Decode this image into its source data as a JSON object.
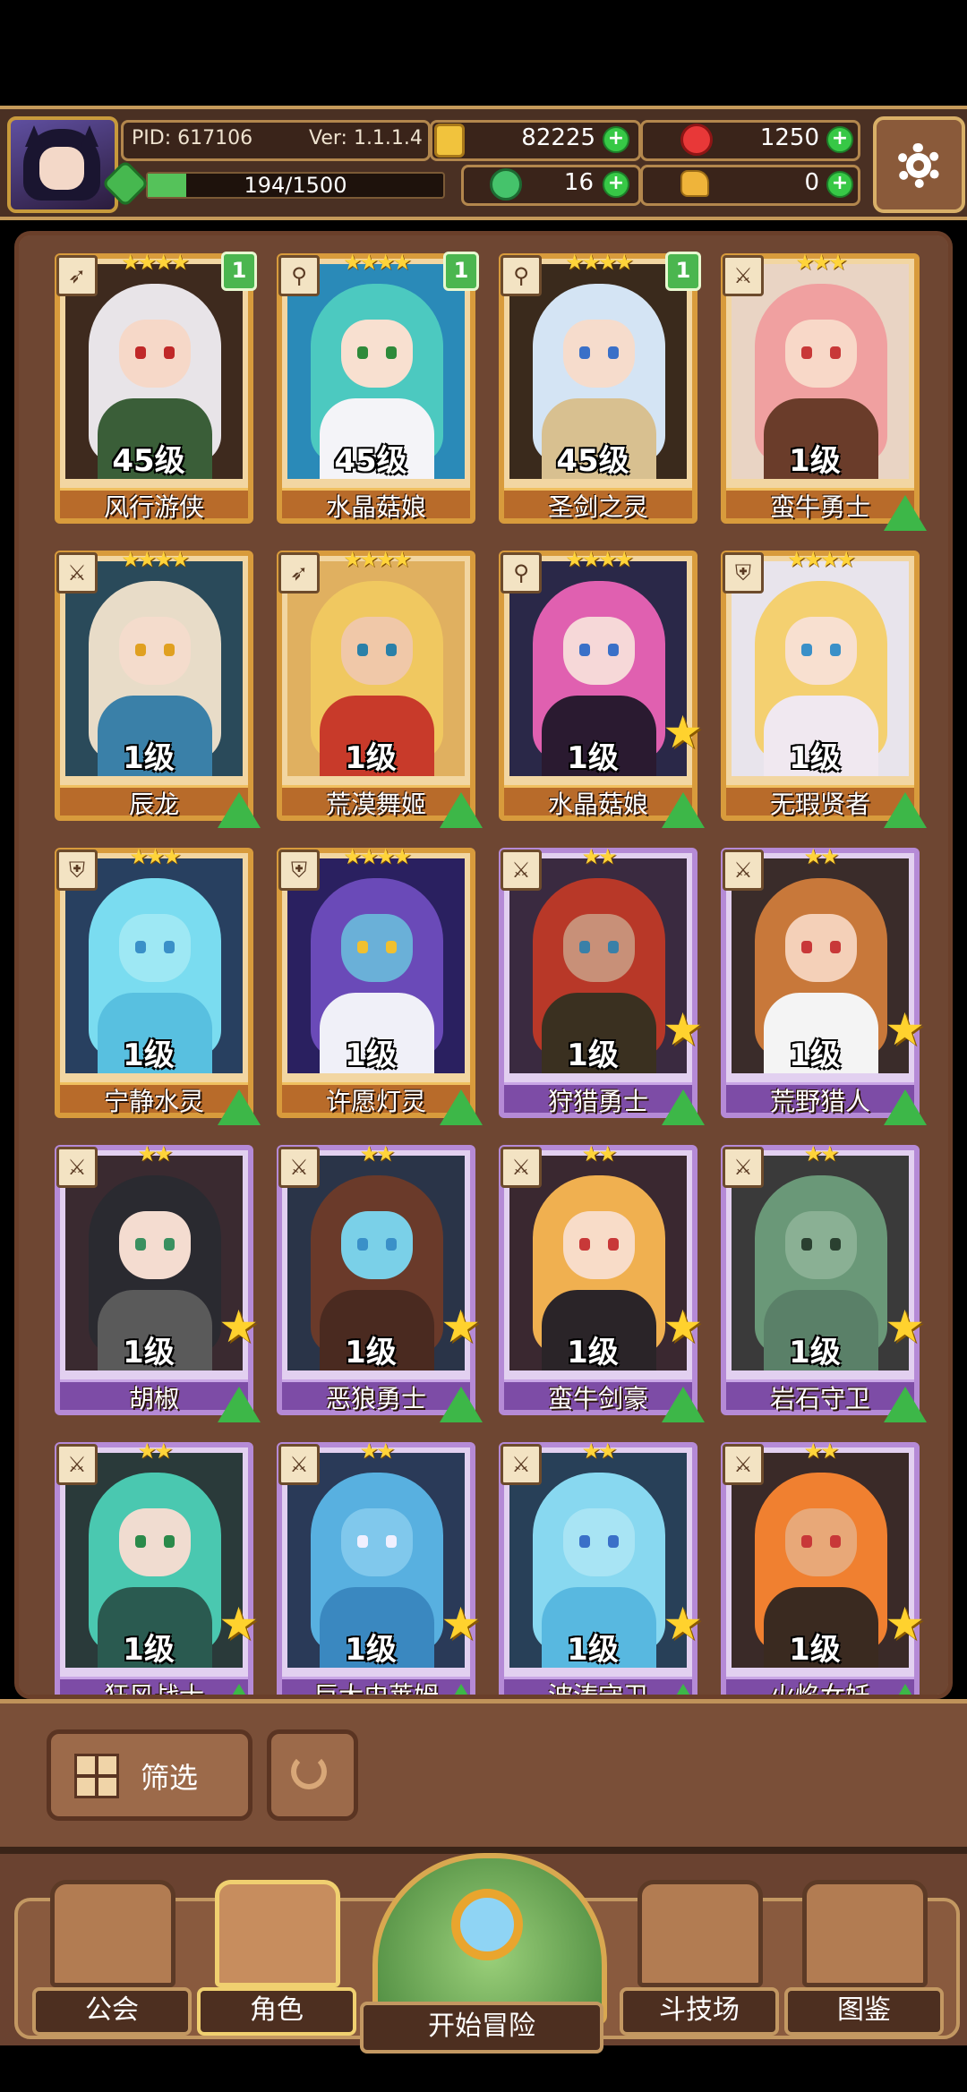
{
  "header": {
    "pid_label": "PID: 617106",
    "version_label": "Ver: 1.1.1.4",
    "gold": "82225",
    "gems": "1250",
    "exp_text": "194/1500",
    "exp_fraction": 0.13,
    "clover": "16",
    "hand_resource": "0"
  },
  "cards": [
    {
      "name": "风行游侠",
      "level": "45级",
      "stars": "★★★★",
      "dup": "1",
      "theme": "gold",
      "class_icon": "bow-icon",
      "hair": "#e8e4e8",
      "skin": "#f6d8c8",
      "outfit": "#3a5e38",
      "eye": "#c02828",
      "bg": "#3e2a1e"
    },
    {
      "name": "水晶菇娘",
      "level": "45级",
      "stars": "★★★★",
      "dup": "1",
      "theme": "gold",
      "class_icon": "staff-icon",
      "hair": "#4cc9c0",
      "skin": "#f8e0d0",
      "outfit": "#f4f4f8",
      "eye": "#2e8a3a",
      "bg": "#2a8ab8"
    },
    {
      "name": "圣剑之灵",
      "level": "45级",
      "stars": "★★★★",
      "dup": "1",
      "theme": "gold",
      "class_icon": "staff-icon",
      "hair": "#d4e4f4",
      "skin": "#f6dccc",
      "outfit": "#d8c090",
      "eye": "#3a70c8",
      "bg": "#3a2a1c"
    },
    {
      "name": "蛮牛勇士",
      "level": "1级",
      "stars": "★★★",
      "dup": "",
      "theme": "gold",
      "class_icon": "sword-icon",
      "hair": "#f0a0a0",
      "skin": "#f8d8c8",
      "outfit": "#6a3c2a",
      "eye": "#c83838",
      "bg": "#e9d4c4"
    },
    {
      "name": "辰龙",
      "level": "1级",
      "stars": "★★★★",
      "dup": "",
      "theme": "gold",
      "class_icon": "sword-icon",
      "hair": "#e8dcc8",
      "skin": "#f4dccc",
      "outfit": "#3a80a8",
      "eye": "#e0a020",
      "bg": "#2a4a5a"
    },
    {
      "name": "荒漠舞姬",
      "level": "1级",
      "stars": "★★★★",
      "dup": "",
      "theme": "gold",
      "class_icon": "bow-icon",
      "hair": "#f0c860",
      "skin": "#f0c8a8",
      "outfit": "#c83a2a",
      "eye": "#2a80a8",
      "bg": "#e0b060"
    },
    {
      "name": "水晶菇娘",
      "level": "1级",
      "stars": "★★★★",
      "dup": "",
      "theme": "gold",
      "class_icon": "staff-icon",
      "hair": "#e060b0",
      "skin": "#f6d8d8",
      "outfit": "#2a1a30",
      "eye": "#3a70c8",
      "bg": "#2a2848"
    },
    {
      "name": "无瑕贤者",
      "level": "1级",
      "stars": "★★★★",
      "dup": "",
      "theme": "gold",
      "class_icon": "shield-icon",
      "hair": "#f4d070",
      "skin": "#f8e0d0",
      "outfit": "#f0e8f0",
      "eye": "#3a90c8",
      "bg": "#e8e4ec"
    },
    {
      "name": "宁静水灵",
      "level": "1级",
      "stars": "★★★",
      "dup": "",
      "theme": "gold",
      "class_icon": "shield-icon",
      "hair": "#7adcf0",
      "skin": "#9ee8f4",
      "outfit": "#58c0e0",
      "eye": "#3a90c8",
      "bg": "#284060"
    },
    {
      "name": "许愿灯灵",
      "level": "1级",
      "stars": "★★★★",
      "dup": "",
      "theme": "gold",
      "class_icon": "shield-icon",
      "hair": "#6a4ab8",
      "skin": "#6ab0d8",
      "outfit": "#f0f0f8",
      "eye": "#f0c030",
      "bg": "#2a2060"
    },
    {
      "name": "狩猎勇士",
      "level": "1级",
      "stars": "★★",
      "dup": "",
      "theme": "purple",
      "class_icon": "sword-icon",
      "hair": "#b83828",
      "skin": "#c89078",
      "outfit": "#3a3020",
      "eye": "#3a80a8",
      "bg": "#3a2a40"
    },
    {
      "name": "荒野猎人",
      "level": "1级",
      "stars": "★★",
      "dup": "",
      "theme": "purple",
      "class_icon": "sword-icon",
      "hair": "#c8783a",
      "skin": "#f4d0b8",
      "outfit": "#f4f4f4",
      "eye": "#c83838",
      "bg": "#3a2c2a"
    },
    {
      "name": "胡椒",
      "level": "1级",
      "stars": "★★",
      "dup": "",
      "theme": "purple",
      "class_icon": "sword-icon",
      "hair": "#2a2a30",
      "skin": "#f4dcd0",
      "outfit": "#5a5a5a",
      "eye": "#3a9060",
      "bg": "#3a2a30"
    },
    {
      "name": "恶狼勇士",
      "level": "1级",
      "stars": "★★",
      "dup": "",
      "theme": "purple",
      "class_icon": "sword-icon",
      "hair": "#6a3a2a",
      "skin": "#7ad0e8",
      "outfit": "#4a2a20",
      "eye": "#3a90c8",
      "bg": "#2a3448"
    },
    {
      "name": "蛮牛剑豪",
      "level": "1级",
      "stars": "★★",
      "dup": "",
      "theme": "purple",
      "class_icon": "sword-icon",
      "hair": "#f0b050",
      "skin": "#f8dcc8",
      "outfit": "#2a2428",
      "eye": "#c83838",
      "bg": "#3a2830"
    },
    {
      "name": "岩石守卫",
      "level": "1级",
      "stars": "★★",
      "dup": "",
      "theme": "purple",
      "class_icon": "sword-icon",
      "hair": "#6a9878",
      "skin": "#8ab094",
      "outfit": "#5a8068",
      "eye": "#2a4030",
      "bg": "#3a3a3a"
    },
    {
      "name": "狂风战士",
      "level": "1级",
      "stars": "★★",
      "dup": "",
      "theme": "purple",
      "class_icon": "sword-icon",
      "hair": "#4ac8b0",
      "skin": "#f0dcd0",
      "outfit": "#2a5a50",
      "eye": "#2a8a4a",
      "bg": "#2a3a3a"
    },
    {
      "name": "巨大史莱姆",
      "level": "1级",
      "stars": "★★",
      "dup": "",
      "theme": "purple",
      "class_icon": "sword-icon",
      "hair": "#58b0e0",
      "skin": "#80c8ec",
      "outfit": "#3a88c0",
      "eye": "#f0f0ff",
      "bg": "#2a3a58"
    },
    {
      "name": "波涛守卫",
      "level": "1级",
      "stars": "★★",
      "dup": "",
      "theme": "purple",
      "class_icon": "sword-icon",
      "hair": "#88d8f0",
      "skin": "#a8e4f4",
      "outfit": "#58b8e0",
      "eye": "#3a70c8",
      "bg": "#284058"
    },
    {
      "name": "火焰女妖",
      "level": "1级",
      "stars": "★★",
      "dup": "",
      "theme": "purple",
      "class_icon": "sword-icon",
      "hair": "#f08030",
      "skin": "#e8a878",
      "outfit": "#3a2a20",
      "eye": "#c83838",
      "bg": "#3a2a28"
    }
  ],
  "filter": {
    "label": "筛选"
  },
  "nav": {
    "guild": "公会",
    "character": "角色",
    "adventure": "开始冒险",
    "arena": "斗技场",
    "codex": "图鉴"
  }
}
